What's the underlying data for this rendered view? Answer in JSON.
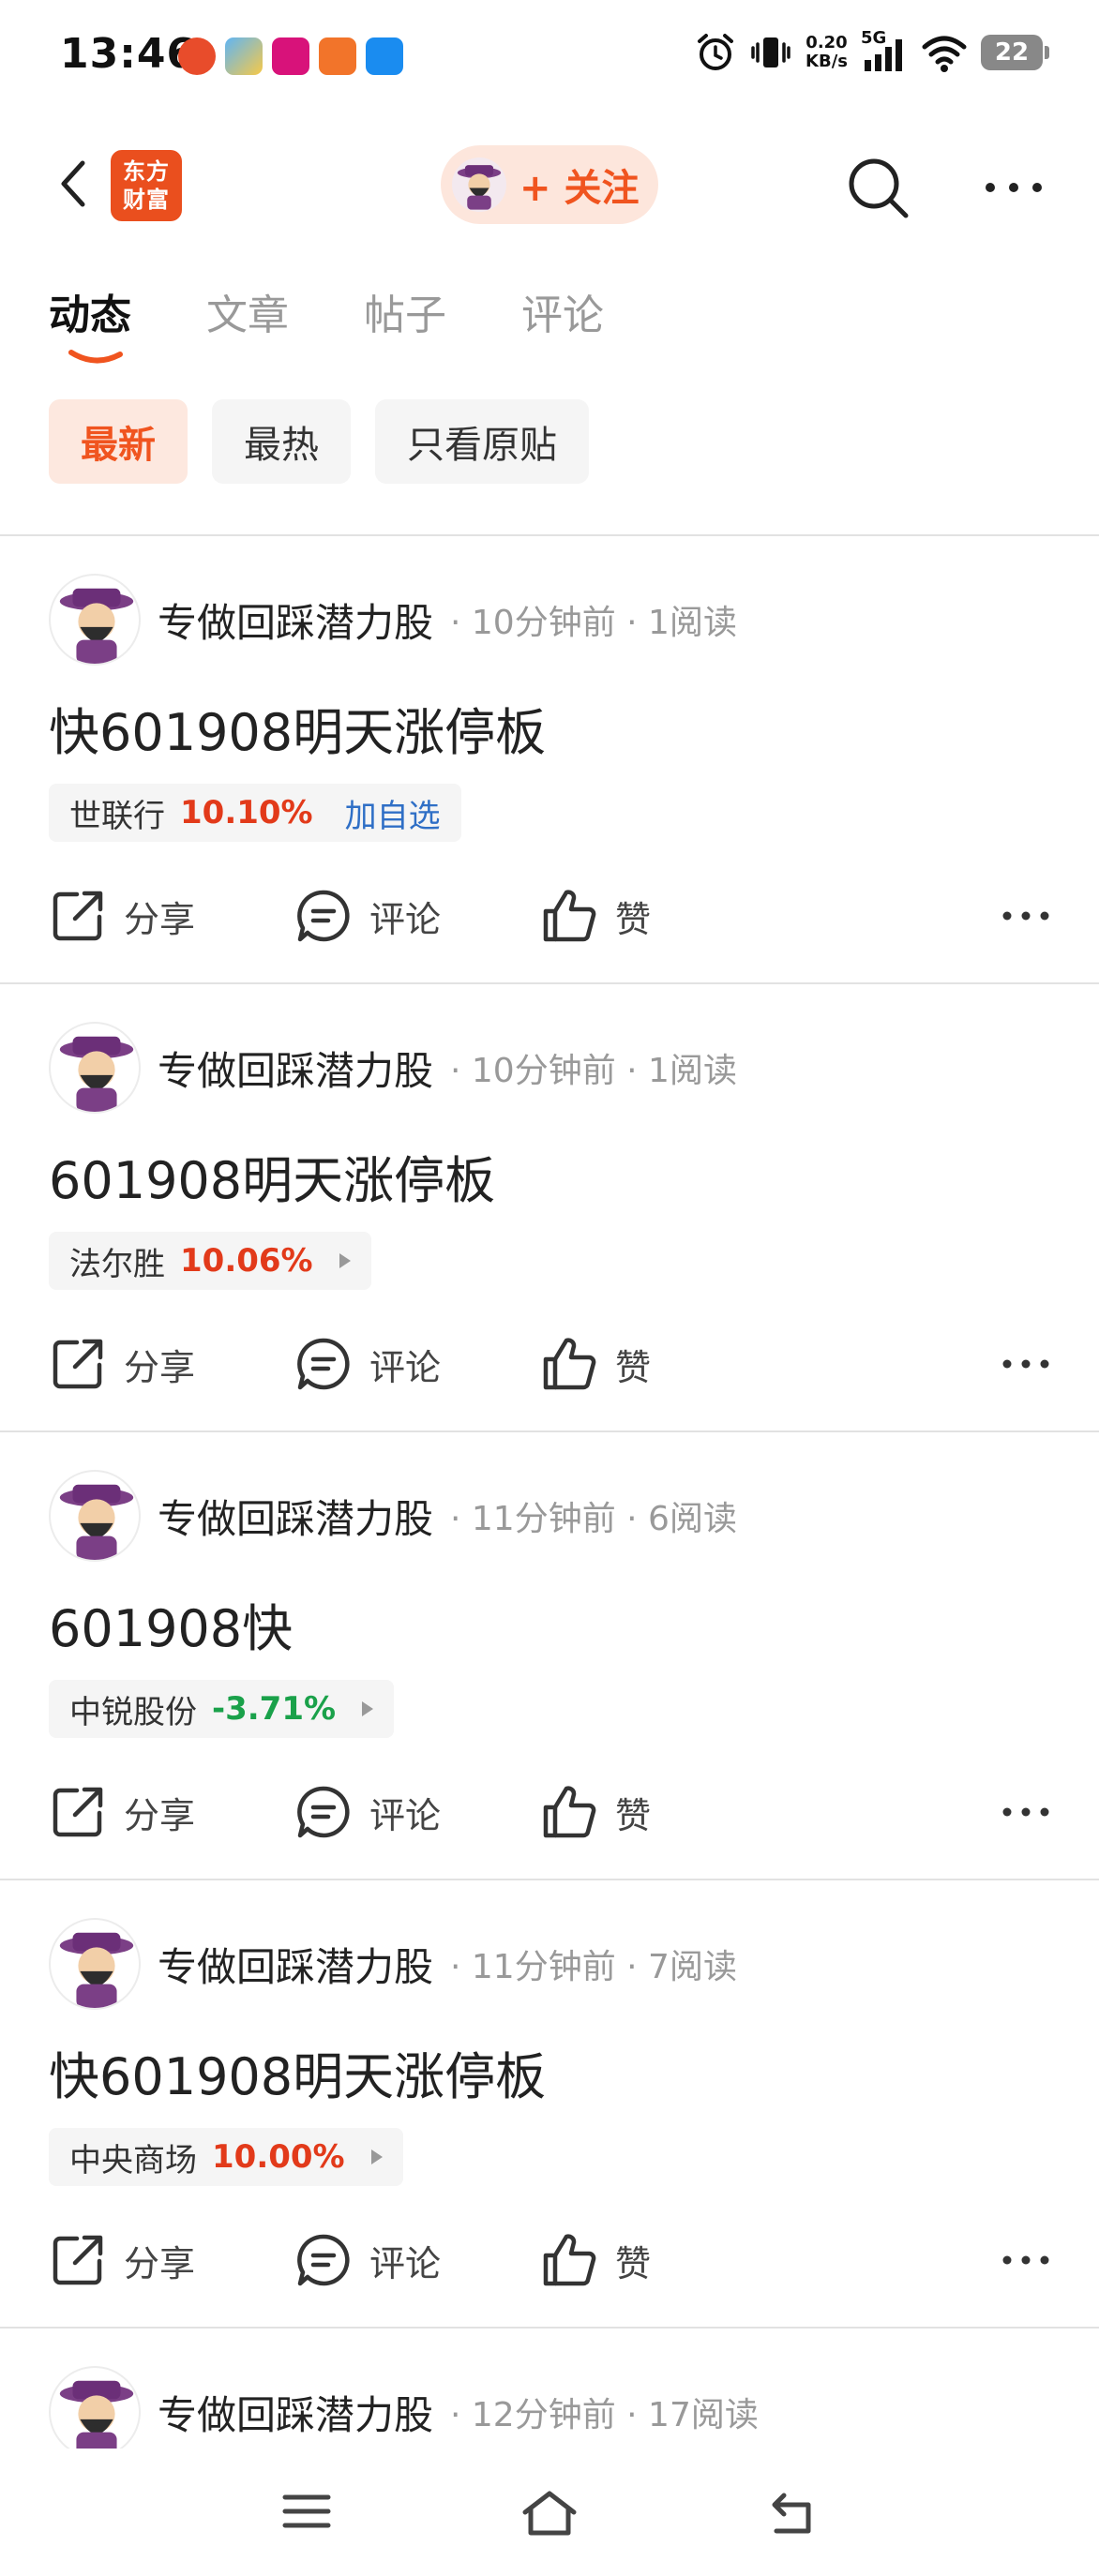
{
  "status_bar": {
    "time": "13:46",
    "net_speed_value": "0.20",
    "net_speed_unit": "KB/s",
    "network": "5G",
    "battery": "22",
    "app_icons": [
      "app-icon-1",
      "app-icon-2",
      "app-icon-3",
      "app-icon-4",
      "app-icon-5"
    ]
  },
  "nav": {
    "logo_line1": "东方",
    "logo_line2": "财富",
    "follow_label": "+ 关注",
    "accent_color": "#f0541f"
  },
  "tabs": [
    {
      "label": "动态",
      "active": true
    },
    {
      "label": "文章",
      "active": false
    },
    {
      "label": "帖子",
      "active": false
    },
    {
      "label": "评论",
      "active": false
    }
  ],
  "filters": [
    {
      "label": "最新",
      "active": true
    },
    {
      "label": "最热",
      "active": false
    },
    {
      "label": "只看原贴",
      "active": false
    }
  ],
  "actions": {
    "share": "分享",
    "comment": "评论",
    "like": "赞"
  },
  "posts": [
    {
      "author": "专做回踩潜力股",
      "meta": "· 10分钟前 · 1阅读",
      "title": "快601908明天涨停板",
      "stock": {
        "name": "世联行",
        "change": "10.10%",
        "direction": "up",
        "extra": "加自选"
      }
    },
    {
      "author": "专做回踩潜力股",
      "meta": "· 10分钟前 · 1阅读",
      "title": "601908明天涨停板",
      "stock": {
        "name": "法尔胜",
        "change": "10.06%",
        "direction": "up",
        "extra": ""
      }
    },
    {
      "author": "专做回踩潜力股",
      "meta": "· 11分钟前 · 6阅读",
      "title": "601908快",
      "stock": {
        "name": "中锐股份",
        "change": "-3.71%",
        "direction": "down",
        "extra": ""
      }
    },
    {
      "author": "专做回踩潜力股",
      "meta": "· 11分钟前 · 7阅读",
      "title": "快601908明天涨停板",
      "stock": {
        "name": "中央商场",
        "change": "10.00%",
        "direction": "up",
        "extra": ""
      }
    },
    {
      "author": "专做回踩潜力股",
      "meta": "· 12分钟前 · 17阅读"
    }
  ]
}
